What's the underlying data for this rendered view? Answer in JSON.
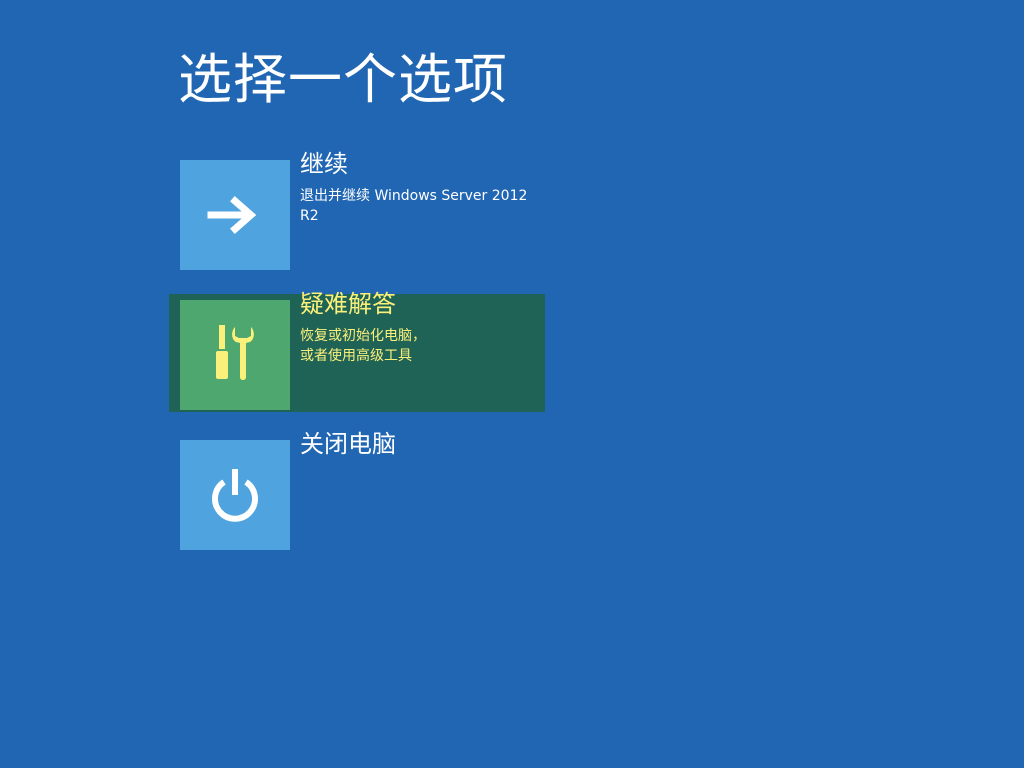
{
  "page": {
    "title": "选择一个选项"
  },
  "options": [
    {
      "title": "继续",
      "description": "退出并继续 Windows Server 2012\nR2",
      "icon": "arrow-right-icon",
      "selected": false
    },
    {
      "title": "疑难解答",
      "description": "恢复或初始化电脑，\n或者使用高级工具",
      "icon": "tools-icon",
      "selected": true
    },
    {
      "title": "关闭电脑",
      "description": "",
      "icon": "power-icon",
      "selected": false
    }
  ],
  "colors": {
    "background": "#2066b3",
    "tile": "#4fa3de",
    "selected_row": "#1f6356",
    "selected_tile": "#4ea76e",
    "selected_text": "#fbf07a"
  }
}
